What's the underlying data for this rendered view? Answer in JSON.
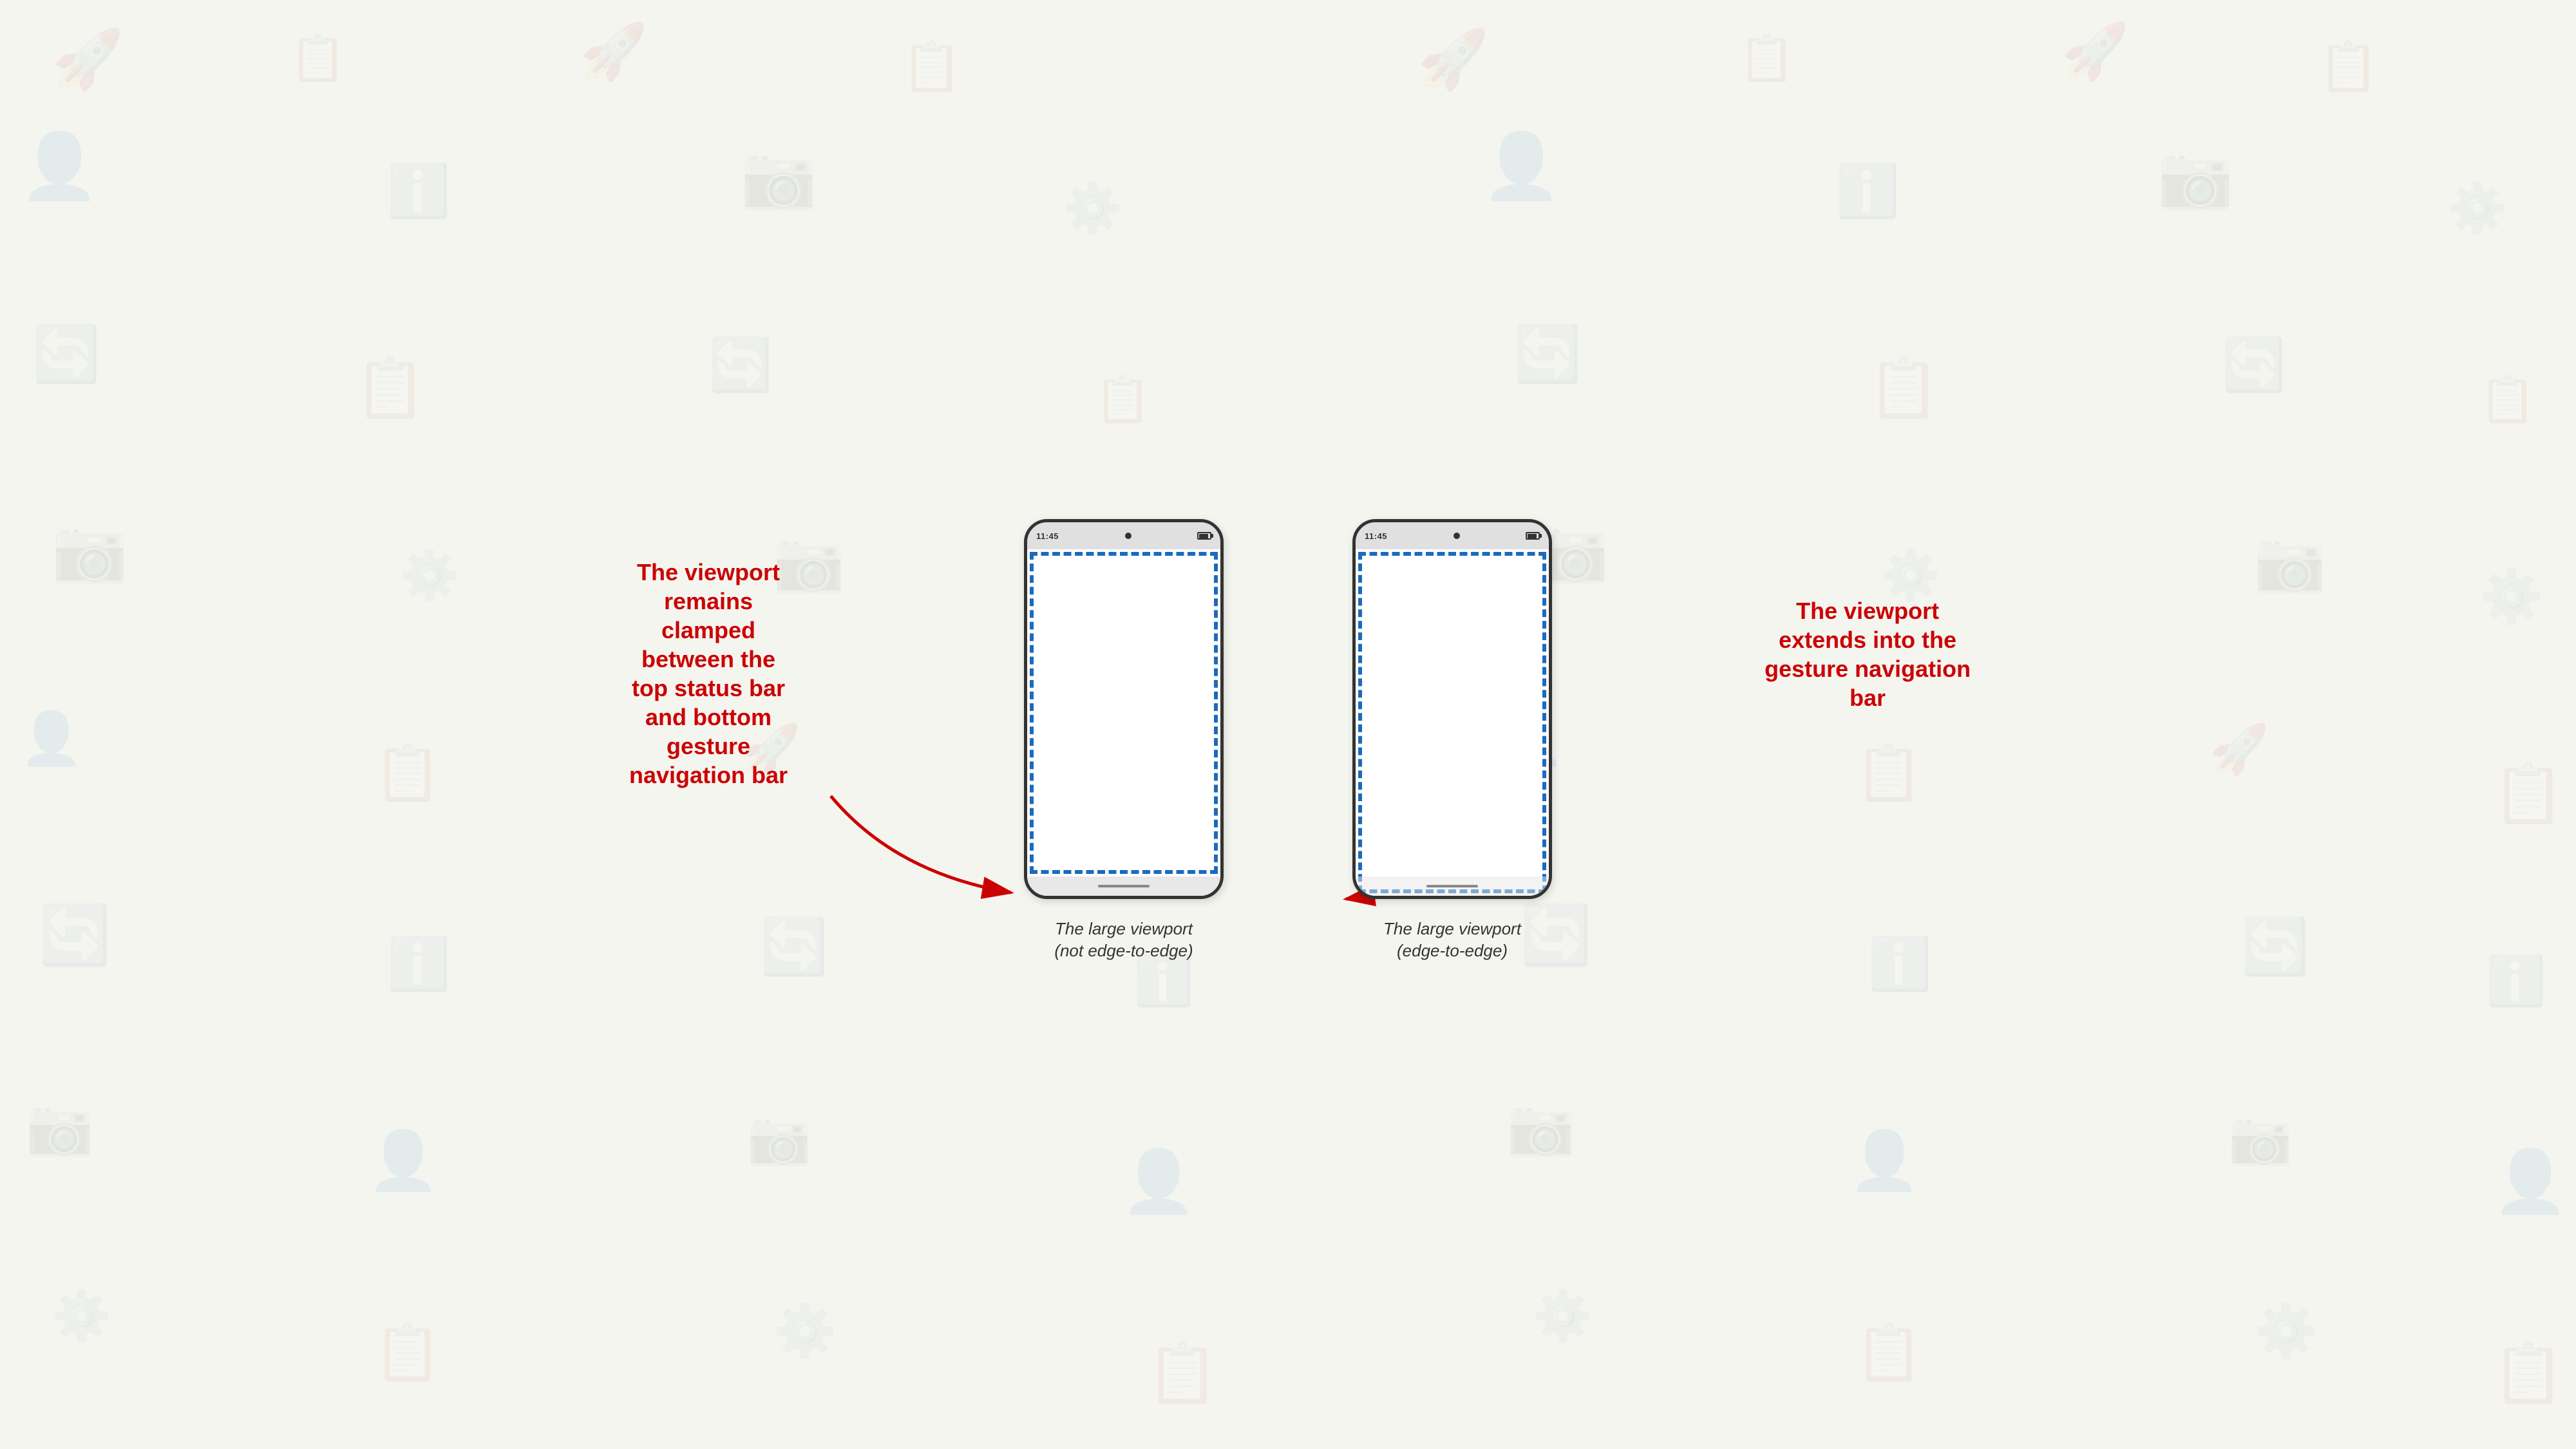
{
  "background": {
    "color": "#f0ede8"
  },
  "phones": [
    {
      "id": "not-edge",
      "status_time": "11:45",
      "caption_line1": "The large viewport",
      "caption_line2": "(not edge-to-edge)",
      "viewport_type": "clamped",
      "annotation": "The viewport\nremains\nclamped\nbetween the\ntop status bar\nand bottom\ngesture\nnavigation bar",
      "annotation_position": "left"
    },
    {
      "id": "edge",
      "status_time": "11:45",
      "caption_line1": "The large viewport",
      "caption_line2": "(edge-to-edge)",
      "viewport_type": "extended",
      "annotation": "The viewport\nextends into the\ngesture navigation\nbar",
      "annotation_position": "right"
    }
  ],
  "colors": {
    "annotation_red": "#cc0000",
    "phone_border": "#333333",
    "dashed_blue": "#1565c0",
    "status_bar_bg": "#e0e0e0",
    "nav_bar_bg": "#e8e8e8"
  }
}
